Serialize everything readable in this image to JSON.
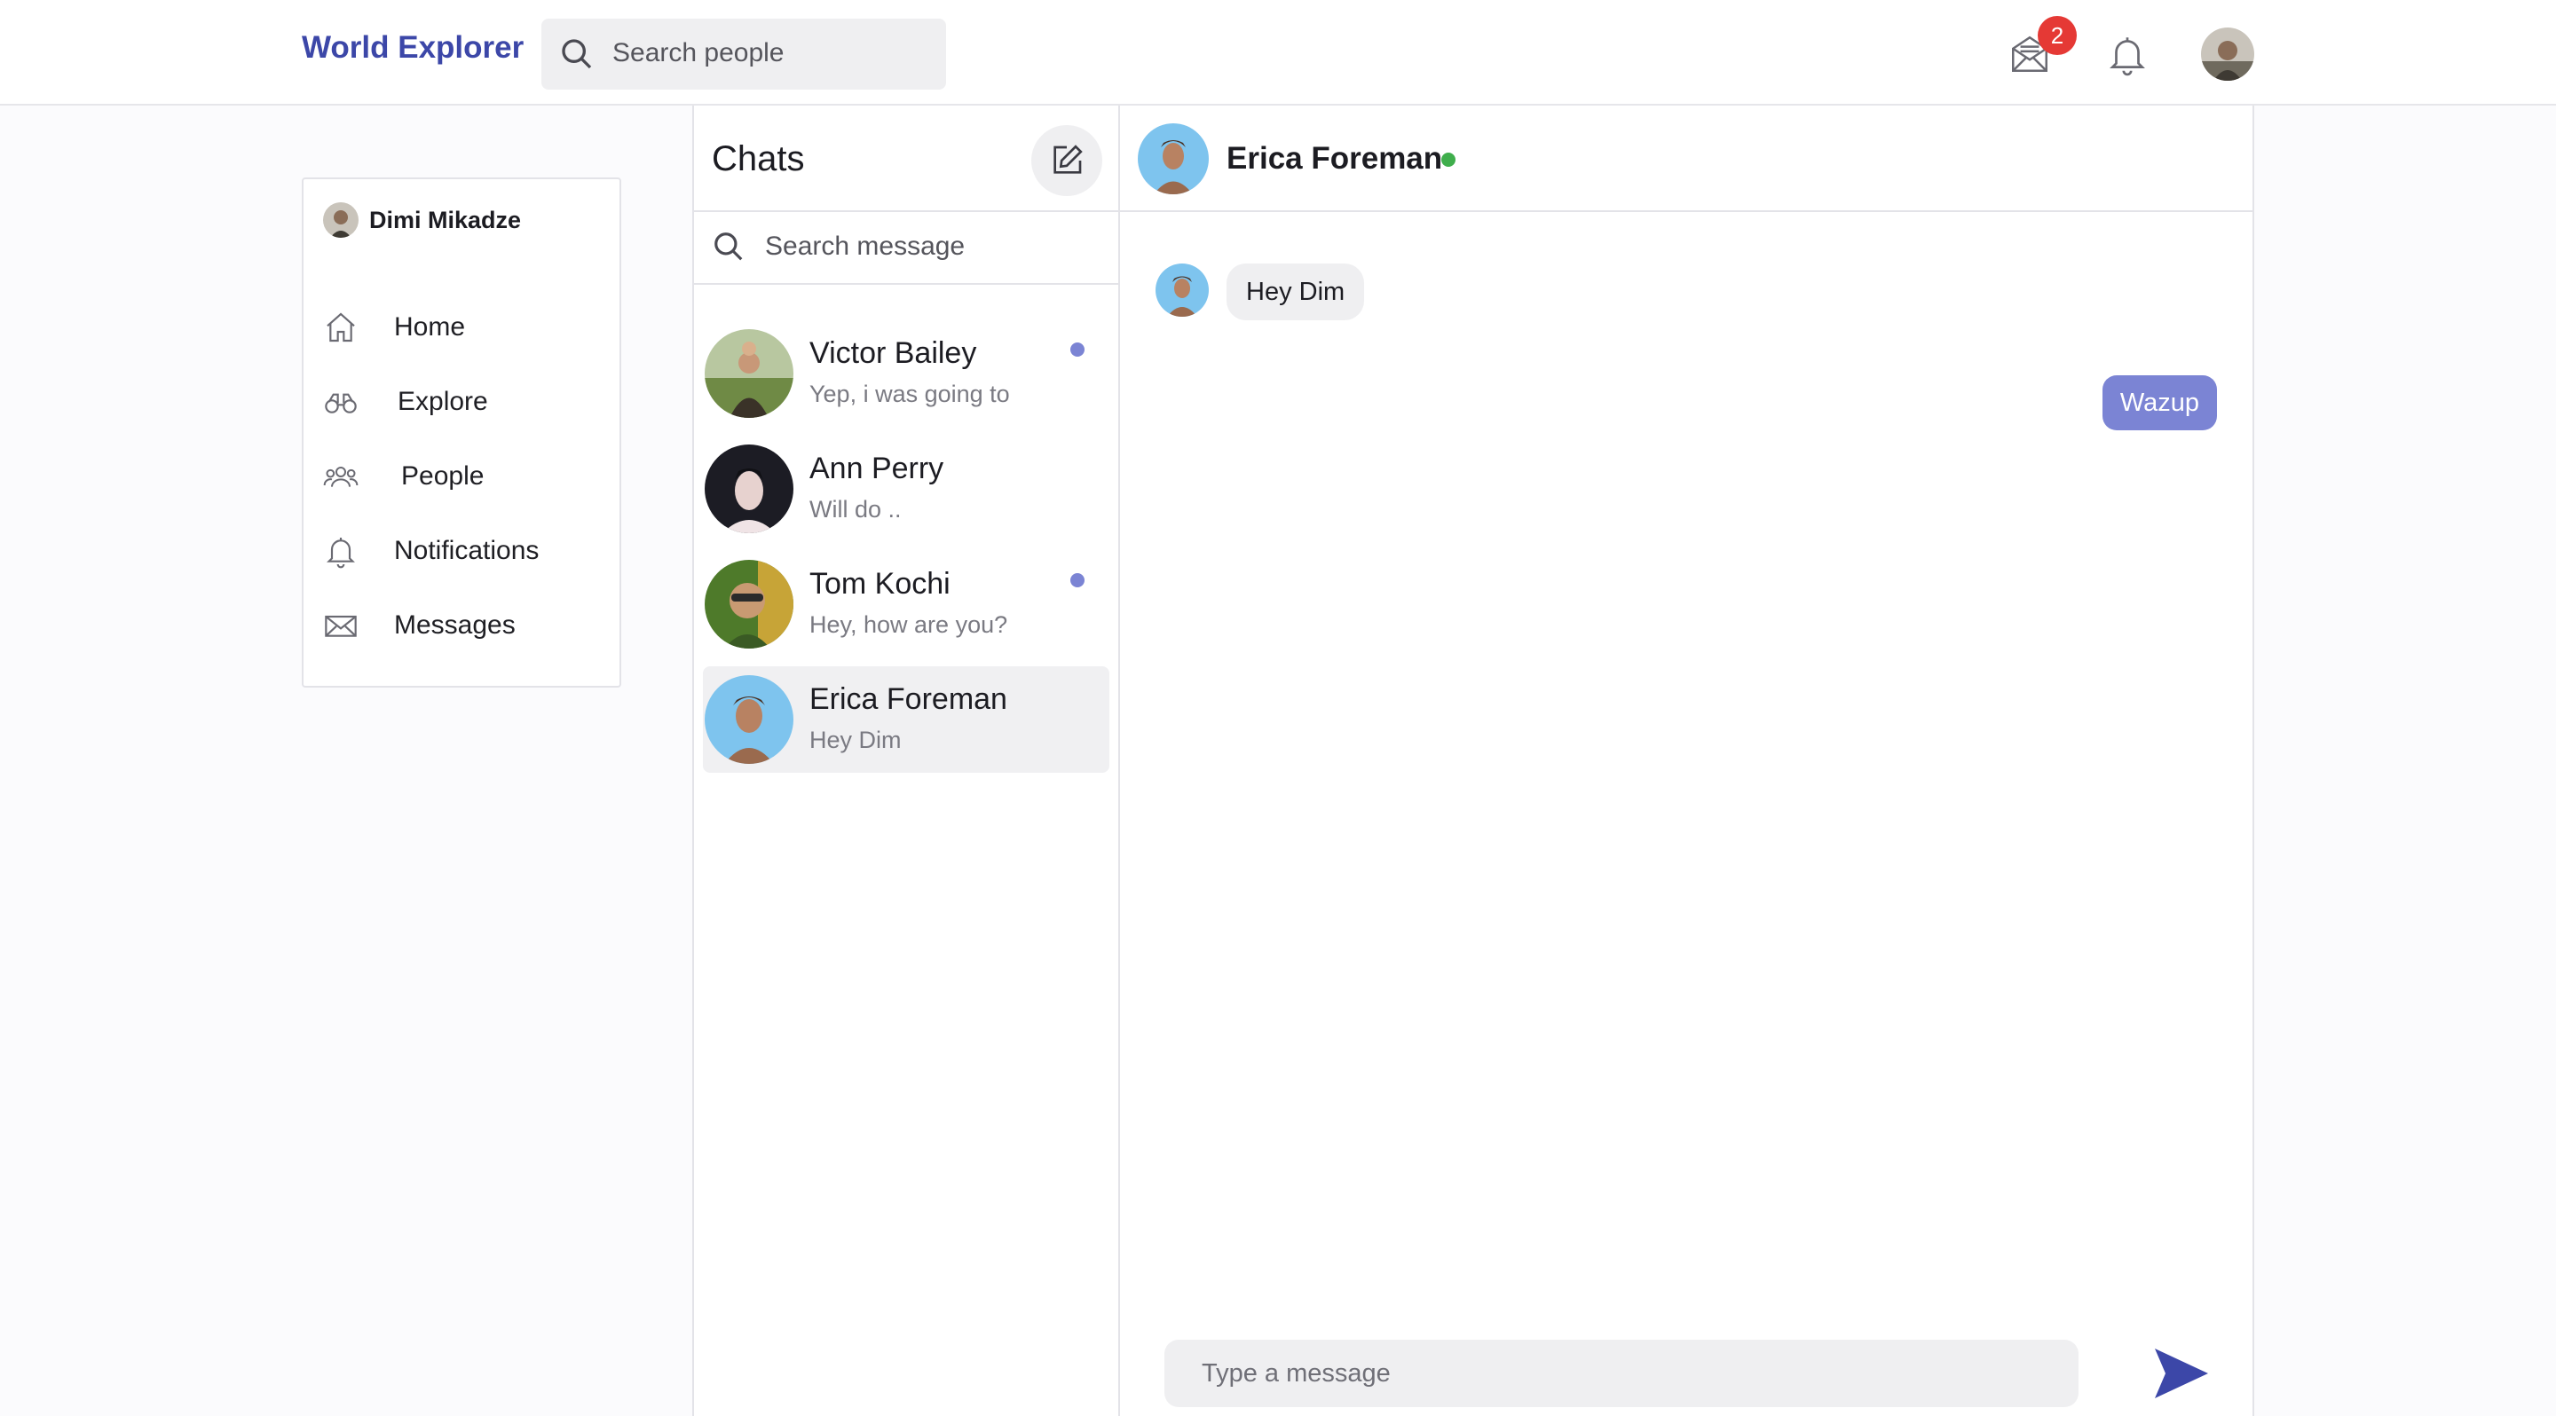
{
  "app": {
    "brand": "World Explorer",
    "search_placeholder": "Search people",
    "mail_badge_count": "2",
    "accent_color": "#3c47a8",
    "badge_color": "#e53935",
    "online_color": "#3fae4c",
    "unread_dot_color": "#7b84d4"
  },
  "sidebar": {
    "user_name": "Dimi Mikadze",
    "items": [
      {
        "label": "Home",
        "icon": "home-icon"
      },
      {
        "label": "Explore",
        "icon": "binoculars-icon"
      },
      {
        "label": "People",
        "icon": "people-icon"
      },
      {
        "label": "Notifications",
        "icon": "bell-icon"
      },
      {
        "label": "Messages",
        "icon": "envelope-icon"
      }
    ]
  },
  "chats": {
    "title": "Chats",
    "search_placeholder": "Search message",
    "items": [
      {
        "name": "Victor Bailey",
        "preview": "Yep, i was going to",
        "unread": true,
        "active": false
      },
      {
        "name": "Ann Perry",
        "preview": "Will do ..",
        "unread": false,
        "active": false
      },
      {
        "name": "Tom Kochi",
        "preview": "Hey, how are you?",
        "unread": true,
        "active": false
      },
      {
        "name": "Erica Foreman",
        "preview": "Hey Dim",
        "unread": false,
        "active": true
      }
    ]
  },
  "conversation": {
    "contact_name": "Erica Foreman",
    "online": true,
    "messages": [
      {
        "direction": "incoming",
        "text": "Hey Dim"
      },
      {
        "direction": "outgoing",
        "text": "Wazup"
      }
    ],
    "input_placeholder": "Type a message"
  }
}
